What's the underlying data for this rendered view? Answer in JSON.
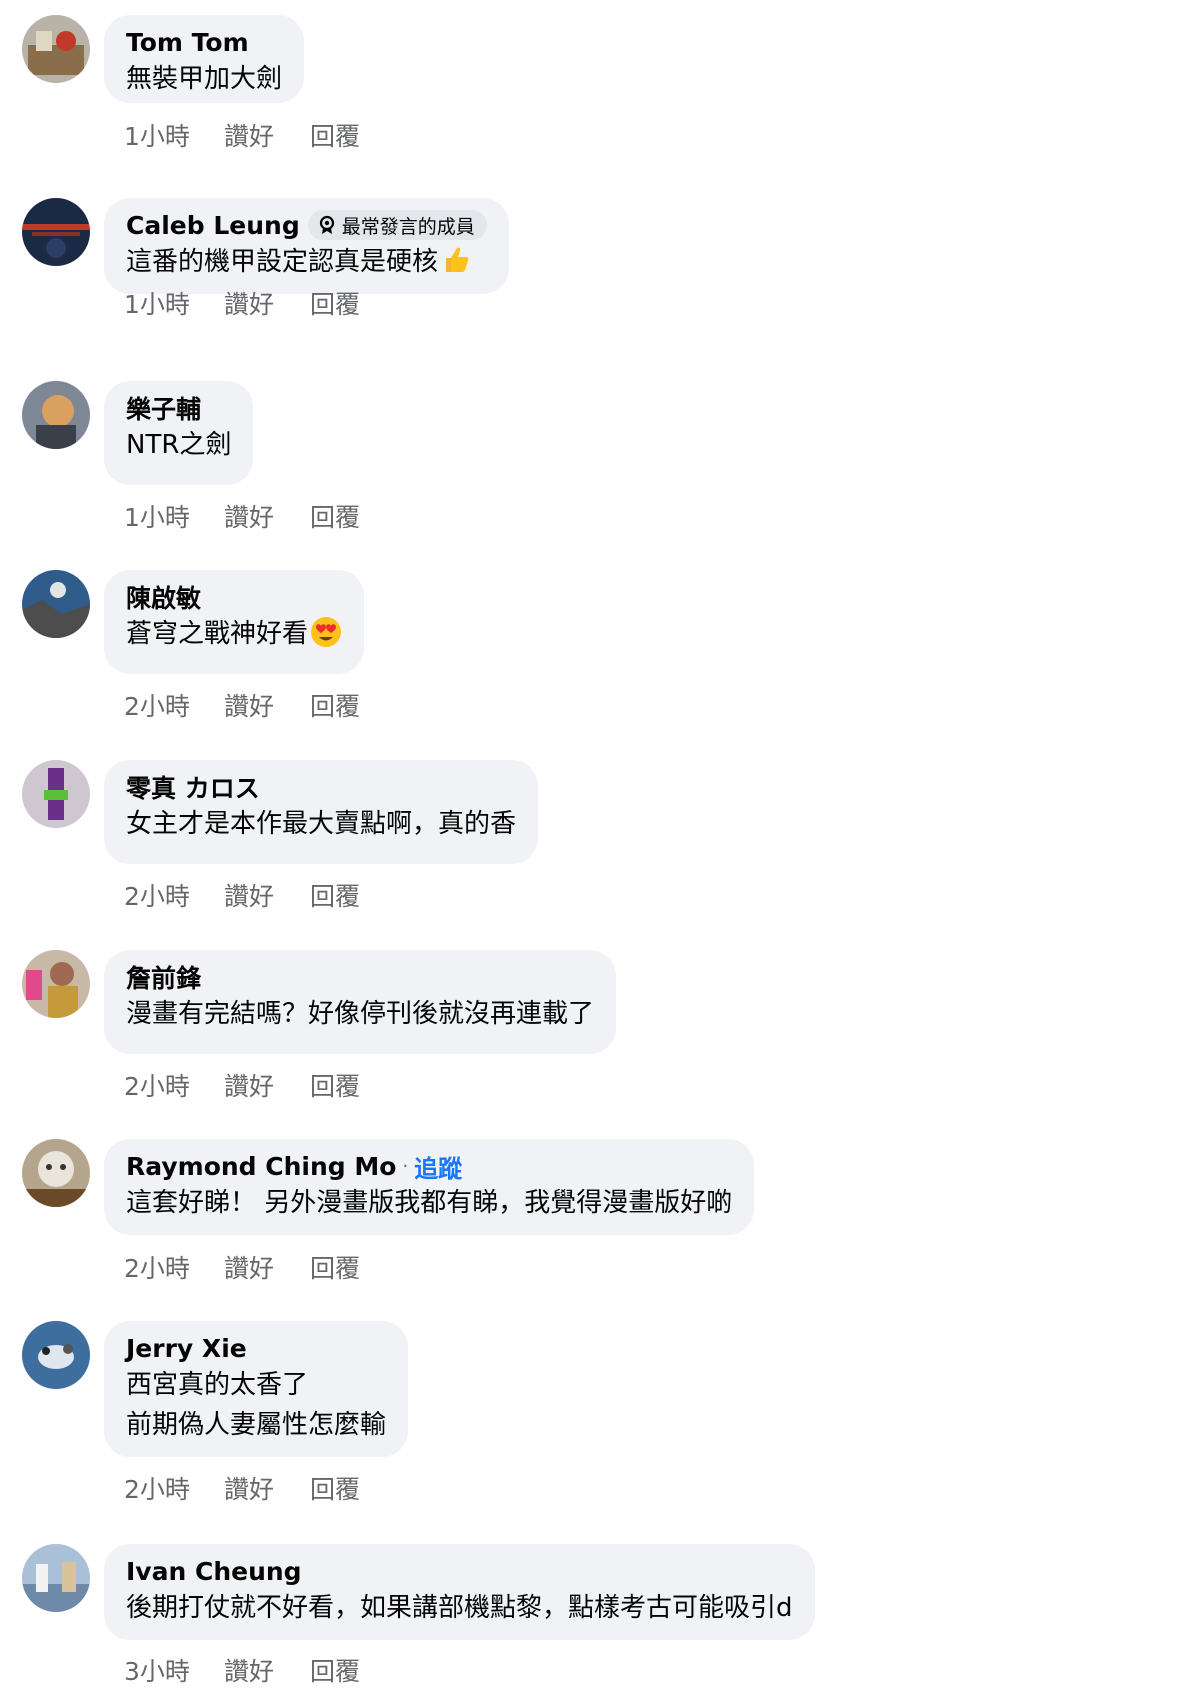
{
  "comments": [
    {
      "name": "Tom Tom",
      "lines": [
        "無裝甲加大劍"
      ],
      "time": "1小時",
      "like": "讚好",
      "reply": "回覆",
      "avatar_color": "#8a6d4a"
    },
    {
      "name": "Caleb Leung",
      "badge": "最常發言的成員",
      "lines": [
        "這番的機甲設定認真是硬核"
      ],
      "emoji": "thumbs-up-emoji",
      "time": "1小時",
      "like": "讚好",
      "reply": "回覆",
      "avatar_color": "#1b2a44"
    },
    {
      "name": "樂子輔",
      "lines": [
        "NTR之劍"
      ],
      "time": "1小時",
      "like": "讚好",
      "reply": "回覆",
      "avatar_color": "#5d6a78"
    },
    {
      "name": "陳啟敏",
      "lines": [
        "蒼穹之戰神好看"
      ],
      "emoji": "heart-eyes-emoji",
      "time": "2小時",
      "like": "讚好",
      "reply": "回覆",
      "avatar_color": "#2f5c8a"
    },
    {
      "name": "零真 カロス",
      "lines": [
        "女主才是本作最大賣點啊，真的香"
      ],
      "time": "2小時",
      "like": "讚好",
      "reply": "回覆",
      "avatar_color": "#6b5a6e"
    },
    {
      "name": "詹前鋒",
      "lines": [
        "漫畫有完結嗎？好像停刊後就沒再連載了"
      ],
      "time": "2小時",
      "like": "讚好",
      "reply": "回覆",
      "avatar_color": "#a06a52"
    },
    {
      "name": "Raymond Ching Mo",
      "follow": "追蹤",
      "lines": [
        "這套好睇！ 另外漫畫版我都有睇，我覺得漫畫版好啲"
      ],
      "time": "2小時",
      "like": "讚好",
      "reply": "回覆",
      "avatar_color": "#8f7c62"
    },
    {
      "name": "Jerry Xie",
      "lines": [
        "西宮真的太香了",
        "前期偽人妻屬性怎麼輸"
      ],
      "time": "2小時",
      "like": "讚好",
      "reply": "回覆",
      "avatar_color": "#3d6e9e"
    },
    {
      "name": "Ivan Cheung",
      "lines": [
        "後期打仗就不好看，如果講部機點黎，點樣考古可能吸引d"
      ],
      "time": "3小時",
      "like": "讚好",
      "reply": "回覆",
      "avatar_color": "#6e8aa8"
    }
  ],
  "colors": {
    "bubble": "#f0f2f5",
    "meta": "#65676b",
    "link": "#1877f2"
  }
}
